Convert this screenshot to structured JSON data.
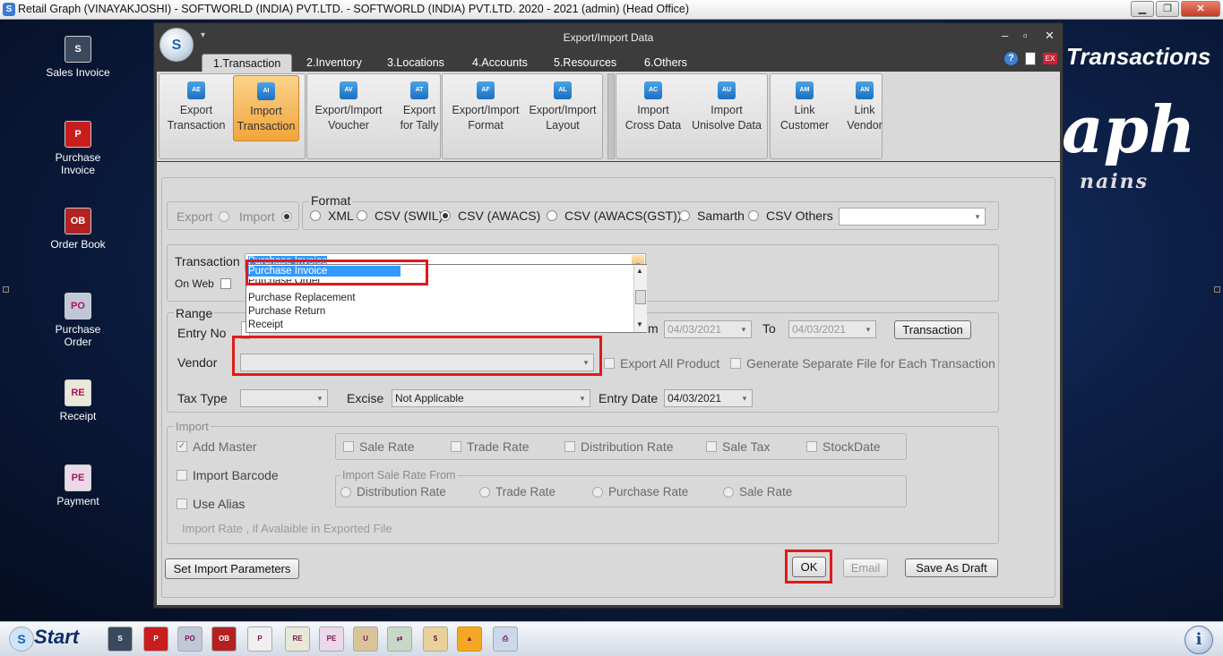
{
  "app": {
    "title": "Retail Graph (VINAYAKJOSHI) - SOFTWORLD (INDIA) PVT.LTD. - SOFTWORLD (INDIA) PVT.LTD.  2020 - 2021 (admin) (Head Office)",
    "min": "▁",
    "max": "❐",
    "close": "✕"
  },
  "desktop": {
    "icons": [
      {
        "label": "Sales Invoice",
        "icon": "sales-invoice-icon",
        "glyph": "S",
        "color": "#3a4a5e"
      },
      {
        "label": "Purchase\nInvoice",
        "icon": "purchase-invoice-icon",
        "glyph": "P",
        "color": "#c81d1d"
      },
      {
        "label": "Order Book",
        "icon": "order-book-icon",
        "glyph": "OB",
        "color": "#b22222"
      },
      {
        "label": "Purchase\nOrder",
        "icon": "purchase-order-icon",
        "glyph": "PO",
        "color": "#c0c8d8"
      },
      {
        "label": "Receipt",
        "icon": "receipt-icon",
        "glyph": "RE",
        "color": "#e8e8d8"
      },
      {
        "label": "Payment",
        "icon": "payment-icon",
        "glyph": "PE",
        "color": "#e9d9e9"
      }
    ],
    "brand_title": "Transactions",
    "brand_logo": "aph",
    "brand_sub": "nains"
  },
  "dialog": {
    "title": "Export/Import Data",
    "orb": "S",
    "min": "–",
    "max": "▫",
    "close": "✕",
    "tabs": [
      "1.Transaction",
      "2.Inventory",
      "3.Locations",
      "4.Accounts",
      "5.Resources",
      "6.Others"
    ],
    "active_tab": 0,
    "ribbon": [
      {
        "label": "Export\nTransaction",
        "icon": "export-transaction-icon",
        "glyph": "AE"
      },
      {
        "label": "Import\nTransaction",
        "icon": "import-transaction-icon",
        "glyph": "AI",
        "active": true
      },
      {
        "label": "Export/Import\nVoucher",
        "icon": "voucher-icon",
        "glyph": "AV"
      },
      {
        "label": "Export\nfor Tally",
        "icon": "tally-icon",
        "glyph": "AT"
      },
      {
        "label": "Export/Import\nFormat",
        "icon": "format-icon",
        "glyph": "AF"
      },
      {
        "label": "Export/Import\nLayout",
        "icon": "layout-icon",
        "glyph": "AL"
      },
      {
        "label": "Import\nCross Data",
        "icon": "cross-data-icon",
        "glyph": "AC"
      },
      {
        "label": "Import\nUnisolve Data",
        "icon": "unisolve-icon",
        "glyph": "AU"
      },
      {
        "label": "Link\nCustomer",
        "icon": "link-customer-icon",
        "glyph": "AM"
      },
      {
        "label": "Link\nVendor",
        "icon": "link-vendor-icon",
        "glyph": "AN"
      }
    ]
  },
  "form": {
    "export_label": "Export",
    "import_label": "Import",
    "format_title": "Format",
    "formats": [
      "XML",
      "CSV (SWIL)",
      "CSV (AWACS)",
      "CSV (AWACS(GST))",
      "Samarth",
      "CSV Others"
    ],
    "selected_format": 2,
    "transaction_label": "Transaction",
    "transaction_value": "Purchase Invoice",
    "onweb_label": "On Web",
    "dropdown_items": [
      "Purchase Invoice",
      "Purchase Order",
      "Purchase Replacement",
      "Purchase Return",
      "Receipt"
    ],
    "range_title": "Range",
    "entry_no_label": "Entry No",
    "from_label_tail": "m",
    "from_date": "04/03/2021",
    "to_label": "To",
    "to_date": "04/03/2021",
    "transaction_btn": "Transaction",
    "vendor_label": "Vendor",
    "export_all_product": "Export All Product",
    "generate_separate": "Generate Separate File for Each Transaction",
    "tax_type_label": "Tax Type",
    "excise_label": "Excise",
    "excise_value": "Not Applicable",
    "entry_date_label": "Entry Date",
    "entry_date_value": "04/03/2021",
    "import_title": "Import",
    "add_master": "Add Master",
    "rates": [
      "Sale Rate",
      "Trade Rate",
      "Distribution Rate",
      "Sale Tax",
      "StockDate"
    ],
    "import_barcode": "Import Barcode",
    "use_alias": "Use Alias",
    "import_sale_rate_from": "Import Sale Rate From",
    "rate_from": [
      "Distribution Rate",
      "Trade Rate",
      "Purchase Rate",
      "Sale Rate"
    ],
    "import_rate_note": "Import Rate , if Avalaible in Exported File",
    "set_import_params": "Set Import Parameters",
    "ok": "OK",
    "email": "Email",
    "save_as_draft": "Save As Draft"
  },
  "taskbar": {
    "start": "Start",
    "items": [
      {
        "icon": "logo-icon",
        "glyph": "S",
        "color": "#cfe4fb"
      },
      {
        "icon": "sales-invoice-icon",
        "glyph": "S",
        "color": "#3a4a5e"
      },
      {
        "icon": "purchase-invoice-icon",
        "glyph": "P",
        "color": "#c81d1d"
      },
      {
        "icon": "purchase-order-icon",
        "glyph": "PO",
        "color": "#c0c8d8"
      },
      {
        "icon": "order-book-icon",
        "glyph": "OB",
        "color": "#b22222"
      },
      {
        "icon": "pos-icon",
        "glyph": "P",
        "color": "#f0f0f0"
      },
      {
        "icon": "receipt-icon",
        "glyph": "RE",
        "color": "#e8e8d8"
      },
      {
        "icon": "payment-icon",
        "glyph": "PE",
        "color": "#e9d9e9"
      },
      {
        "icon": "user-tools-icon",
        "glyph": "U",
        "color": "#d9c49a"
      },
      {
        "icon": "data-transfer-icon",
        "glyph": "⇄",
        "color": "#c8d8c8"
      },
      {
        "icon": "money-bag-icon",
        "glyph": "$",
        "color": "#e8d29a"
      },
      {
        "icon": "shapes-icon",
        "glyph": "▲",
        "color": "#f5b73b"
      },
      {
        "icon": "printer-icon",
        "glyph": "⎙",
        "color": "#cbd8ea"
      }
    ],
    "info": "i"
  }
}
